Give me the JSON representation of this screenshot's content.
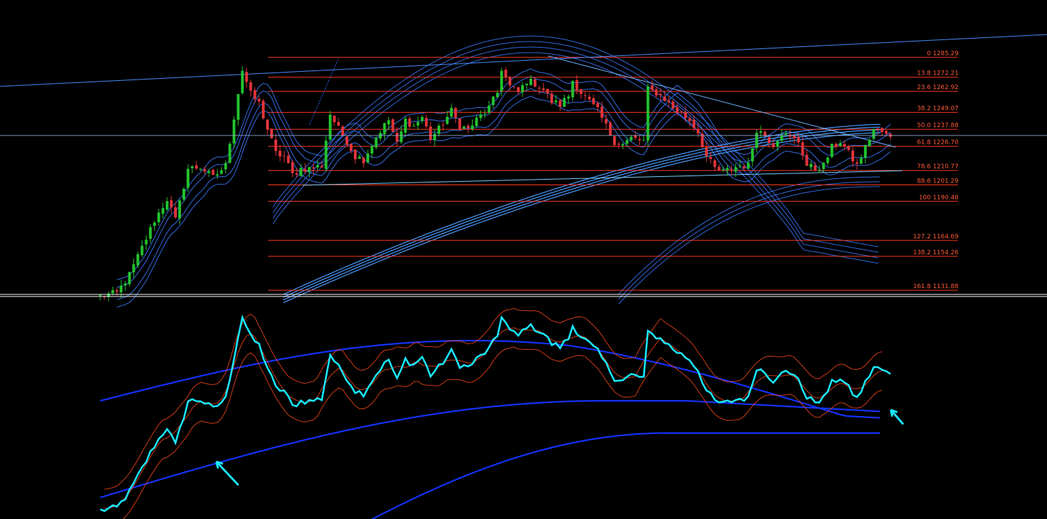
{
  "colors": {
    "background": "#000000",
    "fib_line": "#ff3b1f",
    "fib_label": "#ff5a3a",
    "candle_up": "#22c32e",
    "candle_down": "#e0343a",
    "envelope": "#3a7bff",
    "trendline": "#4b8cff",
    "separator": "#ffffff",
    "osc_main": "#18e8ff",
    "osc_band": "#1433ff",
    "osc_thin": "#ff4a1a"
  },
  "chart_data": [
    {
      "type": "candlestick",
      "panel": "main",
      "fib_levels": [
        {
          "ratio": "0",
          "price": "1285.29"
        },
        {
          "ratio": "13.8",
          "price": "1272.21"
        },
        {
          "ratio": "23.6",
          "price": "1262.92"
        },
        {
          "ratio": "38.2",
          "price": "1249.07"
        },
        {
          "ratio": "50.0",
          "price": "1237.88"
        },
        {
          "ratio": "61.8",
          "price": "1226.70"
        },
        {
          "ratio": "78.6",
          "price": "1210.77"
        },
        {
          "ratio": "88.6",
          "price": "1201.29"
        },
        {
          "ratio": "100",
          "price": "1190.48"
        },
        {
          "ratio": "127.2",
          "price": "1164.69"
        },
        {
          "ratio": "138.2",
          "price": "1154.26"
        },
        {
          "ratio": "161.8",
          "price": "1131.88"
        }
      ],
      "ylim": [
        1128,
        1320
      ],
      "close_path": [
        [
          0,
          1128
        ],
        [
          4,
          1130
        ],
        [
          7,
          1142
        ],
        [
          10,
          1160
        ],
        [
          13,
          1178
        ],
        [
          16,
          1192
        ],
        [
          18,
          1178
        ],
        [
          21,
          1212
        ],
        [
          24,
          1213
        ],
        [
          27,
          1206
        ],
        [
          30,
          1214
        ],
        [
          33,
          1262
        ],
        [
          34,
          1277
        ],
        [
          36,
          1261
        ],
        [
          38,
          1255
        ],
        [
          40,
          1238
        ],
        [
          42,
          1222
        ],
        [
          44,
          1220
        ],
        [
          46,
          1208
        ],
        [
          48,
          1212
        ],
        [
          50,
          1212
        ],
        [
          53,
          1214
        ],
        [
          55,
          1248
        ],
        [
          57,
          1238
        ],
        [
          59,
          1230
        ],
        [
          61,
          1220
        ],
        [
          63,
          1218
        ],
        [
          65,
          1228
        ],
        [
          67,
          1237
        ],
        [
          69,
          1244
        ],
        [
          71,
          1228
        ],
        [
          73,
          1244
        ],
        [
          75,
          1240
        ],
        [
          77,
          1246
        ],
        [
          79,
          1232
        ],
        [
          81,
          1238
        ],
        [
          84,
          1250
        ],
        [
          86,
          1240
        ],
        [
          88,
          1238
        ],
        [
          90,
          1244
        ],
        [
          93,
          1252
        ],
        [
          95,
          1262
        ],
        [
          96,
          1278
        ],
        [
          98,
          1266
        ],
        [
          100,
          1262
        ],
        [
          102,
          1270
        ],
        [
          104,
          1268
        ],
        [
          106,
          1264
        ],
        [
          108,
          1256
        ],
        [
          110,
          1254
        ],
        [
          112,
          1260
        ],
        [
          113,
          1270
        ],
        [
          115,
          1262
        ],
        [
          117,
          1256
        ],
        [
          119,
          1250
        ],
        [
          121,
          1240
        ],
        [
          123,
          1230
        ],
        [
          125,
          1228
        ],
        [
          127,
          1232
        ],
        [
          130,
          1230
        ],
        [
          131,
          1264
        ],
        [
          133,
          1262
        ],
        [
          135,
          1258
        ],
        [
          137,
          1252
        ],
        [
          139,
          1248
        ],
        [
          141,
          1244
        ],
        [
          143,
          1236
        ],
        [
          145,
          1220
        ],
        [
          147,
          1212
        ],
        [
          149,
          1210
        ],
        [
          151,
          1212
        ],
        [
          153,
          1214
        ],
        [
          155,
          1214
        ],
        [
          157,
          1238
        ],
        [
          159,
          1234
        ],
        [
          161,
          1228
        ],
        [
          163,
          1236
        ],
        [
          165,
          1232
        ],
        [
          167,
          1230
        ],
        [
          169,
          1214
        ],
        [
          171,
          1212
        ],
        [
          173,
          1214
        ],
        [
          175,
          1226
        ],
        [
          177,
          1230
        ],
        [
          179,
          1222
        ],
        [
          181,
          1214
        ],
        [
          183,
          1226
        ],
        [
          185,
          1238
        ],
        [
          187,
          1236
        ],
        [
          189,
          1232
        ]
      ]
    },
    {
      "type": "line",
      "panel": "oscillator",
      "ylim": [
        0,
        100
      ],
      "arrows": [
        {
          "at_bar": 34,
          "direction": "up"
        },
        {
          "at_bar": 200,
          "direction": "up"
        }
      ]
    }
  ]
}
